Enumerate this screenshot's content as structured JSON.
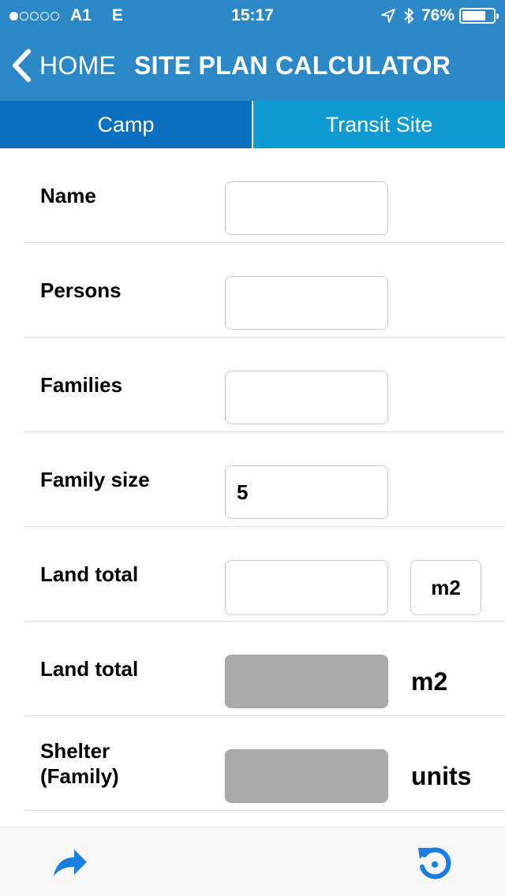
{
  "status_bar": {
    "signal_dots_filled": 1,
    "signal_dots_total": 5,
    "carrier": "A1",
    "network": "E",
    "time": "15:17",
    "battery_text": "76%",
    "battery_level": 0.76,
    "icons": [
      "location-arrow-icon",
      "bluetooth-icon",
      "battery-icon"
    ]
  },
  "nav": {
    "back_label": "HOME",
    "title": "SITE PLAN CALCULATOR"
  },
  "tabs": [
    {
      "label": "Camp",
      "selected": true
    },
    {
      "label": "Transit Site",
      "selected": false
    }
  ],
  "form": {
    "rows": [
      {
        "label": "Name",
        "value": "",
        "readonly": false
      },
      {
        "label": "Persons",
        "value": "",
        "readonly": false
      },
      {
        "label": "Families",
        "value": "",
        "readonly": false
      },
      {
        "label": "Family size",
        "value": "5",
        "readonly": false
      },
      {
        "label": "Land total",
        "value": "",
        "readonly": false,
        "unit_button": "m2"
      },
      {
        "label": "Land total",
        "value": "",
        "readonly": true,
        "unit": "m2"
      },
      {
        "label": "Shelter\n(Family)",
        "value": "",
        "readonly": true,
        "unit": "units"
      }
    ]
  },
  "toolbar": {
    "share_icon": "share-arrow-icon",
    "reset_icon": "reset-icon"
  },
  "colors": {
    "header_blue": "#2d88c8",
    "tab_selected": "#0a6fbf",
    "tab_unselected": "#0e9bd1",
    "toolbar_icon": "#1a7fe0",
    "readonly_field": "#aaaaaa"
  }
}
